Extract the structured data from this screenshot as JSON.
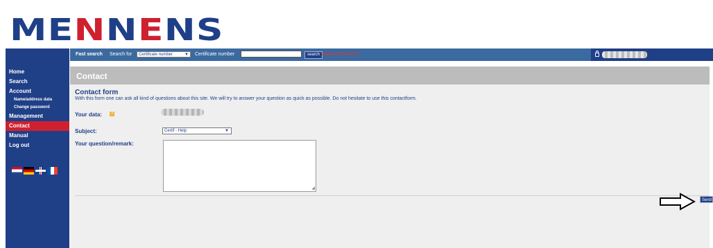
{
  "brand": {
    "logo_blue_1": "ME",
    "logo_red_1": "N",
    "logo_blue_2": "N",
    "logo_red_2": "E",
    "logo_blue_3": "NS"
  },
  "colors": {
    "navy": "#1f3f87",
    "red": "#cf2030",
    "searchbar": "#3b6aa0",
    "title_grey": "#bcbcbc",
    "content_bg": "#efefef"
  },
  "sidebar": {
    "items": [
      {
        "label": "Home"
      },
      {
        "label": "Search"
      },
      {
        "label": "Account"
      },
      {
        "label": "Name/address data"
      },
      {
        "label": "Change password"
      },
      {
        "label": "Management"
      },
      {
        "label": "Contact"
      },
      {
        "label": "Manual"
      },
      {
        "label": "Log out"
      }
    ],
    "flags": [
      "nl-flag-icon",
      "de-flag-icon",
      "uk-flag-icon",
      "fr-flag-icon"
    ]
  },
  "search": {
    "fast_search_label": "Fast search",
    "search_for_label": "Search for",
    "select_value": "Certificate number",
    "cert_label": "Certificate number",
    "input_value": "",
    "button_label": "search",
    "advanced_link": "advanced search"
  },
  "user": {
    "icon": "lock-icon"
  },
  "page": {
    "title": "Contact",
    "form_title": "Contact form",
    "description": "With this form one can ask all kind of questions about this site. We will try to answer your question as quick as possible. Do not hesitate to use this contactform.",
    "your_data_label": "Your data:",
    "subject_label": "Subject:",
    "subject_value": "Certif - Help",
    "question_label": "Your question/remark:",
    "question_value": "",
    "send_label": "Send"
  }
}
